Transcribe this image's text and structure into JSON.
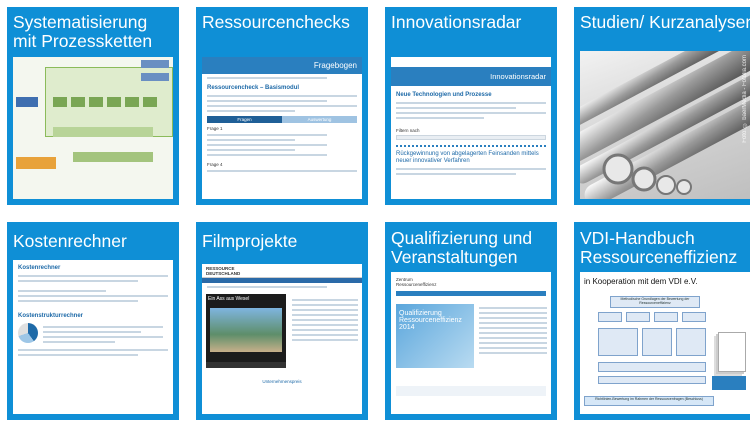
{
  "tiles": [
    {
      "title": "Systematisierung mit Prozessketten"
    },
    {
      "title": "Ressourcenchecks",
      "thumb": {
        "banner": "Fragebogen",
        "heading": "Ressourcencheck – Basismodul",
        "tab_left": "Fragen",
        "tab_right": "Auswertung",
        "q1_label": "Frage 1",
        "q4_label": "Frage 4"
      }
    },
    {
      "title": "Innovationsradar",
      "thumb": {
        "banner": "Innovationsradar",
        "heading": "Neue Technologien und Prozesse",
        "filter_label": "Filtern nach",
        "heading2": "Rückgewinnung von abgelagerten Feinsanden mittels neuer innovativer Verfahren"
      }
    },
    {
      "title": "Studien/ Kurzanalysen",
      "thumb": {
        "credit": "Foto: © baerMedia - Fotolia.com"
      }
    },
    {
      "title": "Kostenrechner",
      "thumb": {
        "heading": "Kostenrechner",
        "subheading": "Kostenstrukturrechner"
      }
    },
    {
      "title": "Filmprojekte",
      "thumb": {
        "logo": "RESSOURCE DEUTSCHLAND",
        "video_title": "Ein Ass aus Wesel",
        "caption": "Unternehmenspreis"
      }
    },
    {
      "title": "Qualifizierung und Veranstaltungen",
      "thumb": {
        "brand": "Zentrum Ressourceneffizienz",
        "banner_title": "Qualifizierung",
        "banner_title2": "Ressourceneffizienz",
        "banner_year": "2014"
      }
    },
    {
      "title": "VDI-Handbuch Ressourceneffizienz",
      "thumb": {
        "cooperation": "in Kooperation  mit dem VDI e.V.",
        "top_box": "Methodische Grundlagen der Bewertung der Ressourceneffizienz",
        "bottom_box": "Richtlinien-Bewertung im Rahmen der Ressourcenfragen (Beschluss)"
      }
    }
  ]
}
